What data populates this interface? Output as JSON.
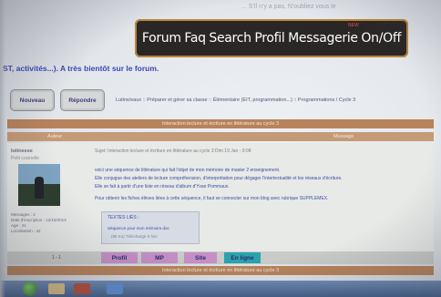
{
  "topbar": {
    "text": "... S'Il n'y a pas, N'oubliez vous le"
  },
  "nav": {
    "items": [
      "Forum",
      "Faq",
      "Search",
      "Profil",
      "Messagerie",
      "On/Off"
    ],
    "new_badge": "NEW"
  },
  "welcome": {
    "text": "ST, activités...). A très bientôt sur le forum."
  },
  "buttons": {
    "new_topic": "Nouveau",
    "reply": "Répondre"
  },
  "breadcrumb": "Lutins/eaux :: Préparer et gérer sa classe :: Élémentaire (EIT, programmation...) :: Programmations / Cycle 3",
  "thread": {
    "title": "Interaction lecture et écriture en littérature au cycle 3",
    "col_author": "Auteur",
    "col_message": "Message"
  },
  "author": {
    "name": "lutinesse",
    "rank": "Petit cocinelle",
    "stats": [
      "Messages : 2",
      "Date d'inscription : 12/10/2013",
      "Age : 41",
      "Localisation : 42"
    ]
  },
  "post": {
    "subject": "Sujet: Interaction lecture et écriture en littérature au cycle 3   Dim 19 Jan - 9:08",
    "body": [
      "voici une séquence de littérature qui fait l'objet de mon mémoire de master 2 enseignement.",
      "Elle conjugue des ateliers de lecture compréhension, d'interprétation pour dégager l'intertextualité et les réseaux d'écriture.",
      "Elle se fait à partir d'une liste en réseau d'album d'Yvan Pommaux.",
      "Pour obtenir les fiches élèves liées à cette séquence, il faut se connecter sur mon blog avec rubrique SUPPLEMEX."
    ],
    "quote": {
      "title": "TEXTES LIÉS :",
      "file": "Séquence pour mon mémoire.doc",
      "meta": "(95 Ko) Téléchargé 5 fois"
    }
  },
  "profile_bar": {
    "page_ref": "1 - 1",
    "profil": "Profil",
    "mp": "MP",
    "site": "Site",
    "online": "En ligne"
  },
  "next_thread": {
    "title": "Interaction lecture et écriture en littérature au cycle 3"
  }
}
